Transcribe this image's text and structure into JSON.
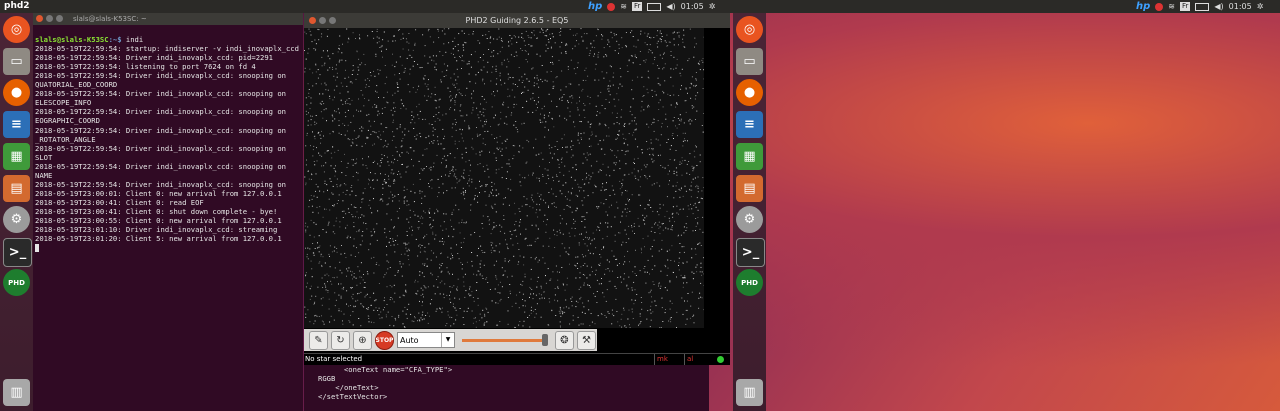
{
  "topbar": {
    "app_title": "phd2",
    "tray": {
      "vendor": "hp",
      "keyboard": "Fr",
      "time": "01:05"
    }
  },
  "terminal": {
    "title": "slals@slals-K53SC: ~",
    "prompt_user": "slals@slals-K53SC",
    "prompt_path": ":~$",
    "command": " indi",
    "lines": [
      "2018-05-19T22:59:54: startup: indiserver -v indi_inovaplx_ccd",
      "2018-05-19T22:59:54: Driver indi_inovaplx_ccd: pid=2291",
      "2018-05-19T22:59:54: listening to port 7624 on fd 4",
      "2018-05-19T22:59:54: Driver indi_inovaplx_ccd: snooping on",
      "QUATORIAL_EOD_COORD",
      "2018-05-19T22:59:54: Driver indi_inovaplx_ccd: snooping on",
      "ELESCOPE_INFO",
      "2018-05-19T22:59:54: Driver indi_inovaplx_ccd: snooping on",
      "EOGRAPHIC_COORD",
      "2018-05-19T22:59:54: Driver indi_inovaplx_ccd: snooping on",
      "_ROTATOR_ANGLE",
      "2018-05-19T22:59:54: Driver indi_inovaplx_ccd: snooping on",
      "SLOT",
      "2018-05-19T22:59:54: Driver indi_inovaplx_ccd: snooping on",
      "NAME",
      "2018-05-19T22:59:54: Driver indi_inovaplx_ccd: snooping on",
      "2018-05-19T23:00:01: Client 0: new arrival from 127.0.0.1",
      "2018-05-19T23:00:41: Client 0: read EOF",
      "2018-05-19T23:00:41: Client 0: shut down complete - bye!",
      "2018-05-19T23:00:55: Client 0: new arrival from 127.0.0.1",
      "2018-05-19T23:01:10: Driver indi_inovaplx_ccd: streaming",
      "2018-05-19T23:01:20: Client 5: new arrival from 127.0.0.1"
    ]
  },
  "phd": {
    "title": "PHD2 Guiding 2.6.5 - EQ5",
    "exposure": "Auto",
    "exposure_options": [
      "Auto"
    ],
    "gamma_level": 0.95,
    "stop_label": "STOP",
    "status": {
      "message": "No star selected",
      "cell1": "mk",
      "cell2": "al"
    }
  },
  "bottom_terminal": {
    "lines": [
      "      <oneText name=\"CFA_TYPE\">",
      "RGGB",
      "    </oneText>",
      "</setTextVector>"
    ]
  },
  "launcher_icons": [
    "ubuntu-icon",
    "files-icon",
    "firefox-icon",
    "writer-icon",
    "calc-icon",
    "impress-icon",
    "settings-icon",
    "terminal-icon",
    "phd-icon",
    "trash-icon"
  ]
}
